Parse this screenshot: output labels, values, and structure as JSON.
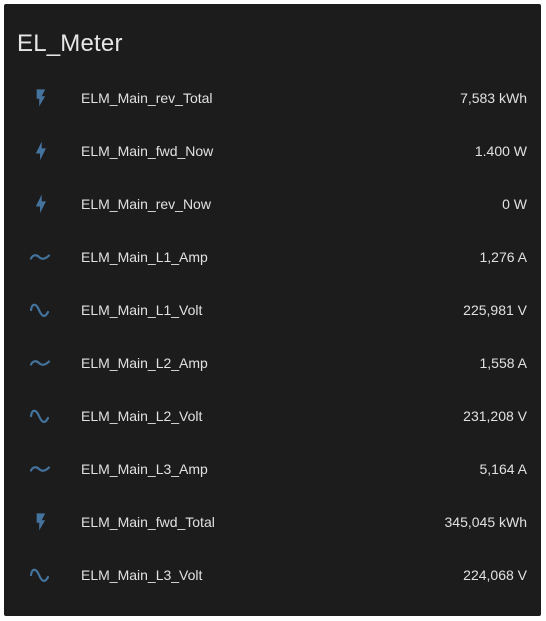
{
  "card": {
    "title": "EL_Meter"
  },
  "colors": {
    "background": "#1c1c1c",
    "icon": "#44739e",
    "text": "#e1e1e1"
  },
  "entities": [
    {
      "icon": "flash-icon",
      "name": "ELM_Main_rev_Total",
      "value": "7,583 kWh"
    },
    {
      "icon": "lightning-bolt-icon",
      "name": "ELM_Main_fwd_Now",
      "value": "1.400 W"
    },
    {
      "icon": "lightning-bolt-icon",
      "name": "ELM_Main_rev_Now",
      "value": "0 W"
    },
    {
      "icon": "current-ac-icon",
      "name": "ELM_Main_L1_Amp",
      "value": "1,276 A"
    },
    {
      "icon": "sine-wave-icon",
      "name": "ELM_Main_L1_Volt",
      "value": "225,981 V"
    },
    {
      "icon": "current-ac-icon",
      "name": "ELM_Main_L2_Amp",
      "value": "1,558 A"
    },
    {
      "icon": "sine-wave-icon",
      "name": "ELM_Main_L2_Volt",
      "value": "231,208 V"
    },
    {
      "icon": "current-ac-icon",
      "name": "ELM_Main_L3_Amp",
      "value": "5,164 A"
    },
    {
      "icon": "flash-icon",
      "name": "ELM_Main_fwd_Total",
      "value": "345,045 kWh"
    },
    {
      "icon": "sine-wave-icon",
      "name": "ELM_Main_L3_Volt",
      "value": "224,068 V"
    }
  ]
}
